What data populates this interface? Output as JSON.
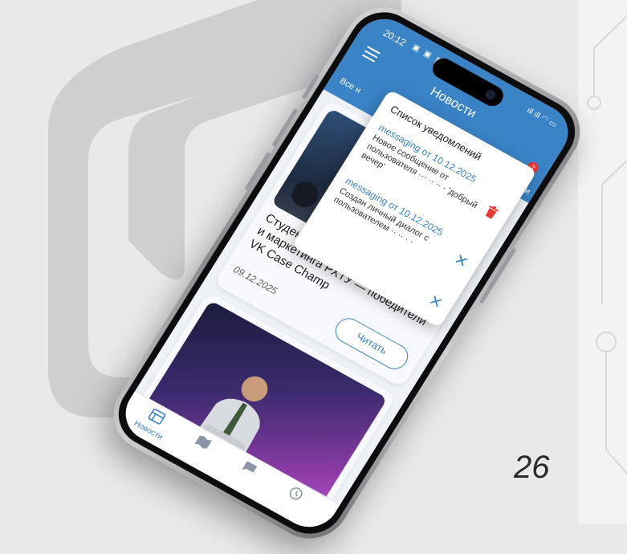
{
  "slide": {
    "number": "26"
  },
  "status": {
    "time": "20:12",
    "icons": "▣ ▣ ▣ ··",
    "right": "ıll ıll ◠ ▭"
  },
  "app": {
    "title": "Новости",
    "filter_left": "Все н",
    "filter_right": "и",
    "badge_count": "2"
  },
  "notifications": {
    "heading": "Список уведомлений",
    "items": [
      {
        "title": "messaging от 10.12.2025",
        "text": "Новое сообщение от пользователя ··· ·· ·· · 'добрый вечер'"
      },
      {
        "title": "messaging от 10.12.2025",
        "text": "Создан личный диалог с пользователем ·· ·· · ·"
      }
    ]
  },
  "cards": [
    {
      "title": "Студенты кафедры менеджмента и маркетинга РХТУ — победители VK Case Champ",
      "date": "09.12.2025",
      "read_label": "Читать"
    }
  ],
  "nav": {
    "items": [
      {
        "label": "Новости"
      }
    ]
  },
  "colors": {
    "accent": "#3a83c6",
    "delete": "#e53935"
  }
}
